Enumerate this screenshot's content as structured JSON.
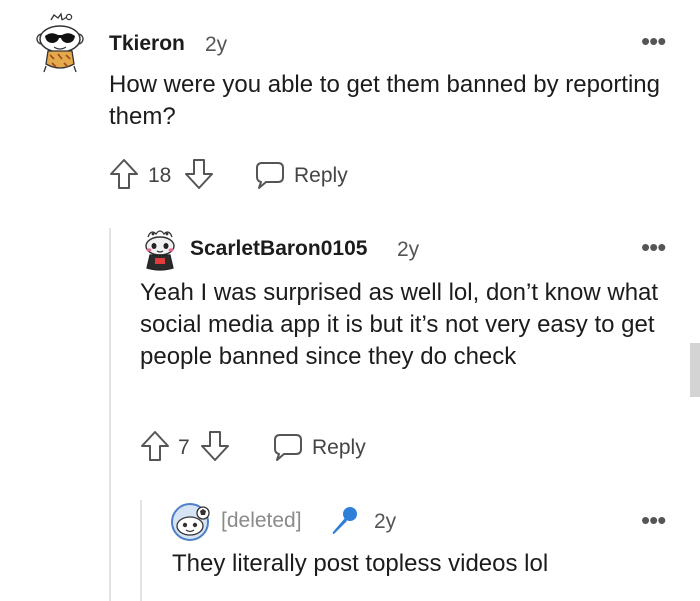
{
  "comments": [
    {
      "author": "Tkieron",
      "age": "2y",
      "text": "How were you able to get them banned by reporting them?",
      "votes": "18",
      "reply_label": "Reply",
      "more": "•••"
    },
    {
      "author": "ScarletBaron0105",
      "age": "2y",
      "text": "Yeah I was surprised as well lol, don’t know what social media app it is but it’s not very easy to get people banned since they do check",
      "votes": "7",
      "reply_label": "Reply",
      "more": "•••"
    },
    {
      "author": "[deleted]",
      "age": "2y",
      "text": "They literally post topless videos lol",
      "more": "•••"
    }
  ],
  "colors": {
    "accent_blue": "#2f7fd8",
    "thread_line": "#e3e3e3"
  }
}
